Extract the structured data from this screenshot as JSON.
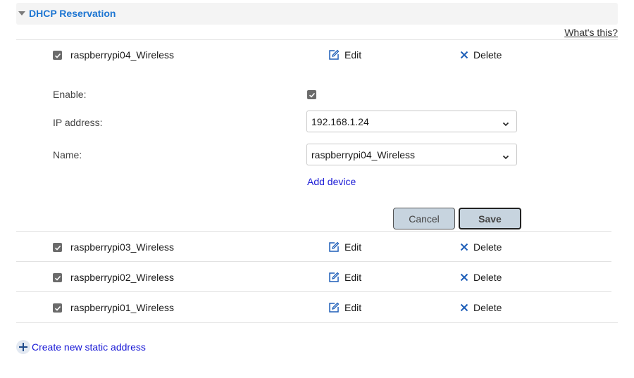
{
  "section": {
    "title": "DHCP Reservation",
    "help_link": "What's this?"
  },
  "reservations": [
    {
      "name": "raspberrypi04_Wireless",
      "edit": "Edit",
      "delete": "Delete"
    },
    {
      "name": "raspberrypi03_Wireless",
      "edit": "Edit",
      "delete": "Delete"
    },
    {
      "name": "raspberrypi02_Wireless",
      "edit": "Edit",
      "delete": "Delete"
    },
    {
      "name": "raspberrypi01_Wireless",
      "edit": "Edit",
      "delete": "Delete"
    }
  ],
  "editor": {
    "enable_label": "Enable:",
    "ip_label": "IP address:",
    "ip_value": "192.168.1.24",
    "name_label": "Name:",
    "name_value": "raspberrypi04_Wireless",
    "add_device": "Add device",
    "cancel": "Cancel",
    "save": "Save"
  },
  "create_link": "Create new static address",
  "colors": {
    "accent": "#1e76d2",
    "link": "#1a1ad6",
    "button_bg": "#c7d4df"
  }
}
